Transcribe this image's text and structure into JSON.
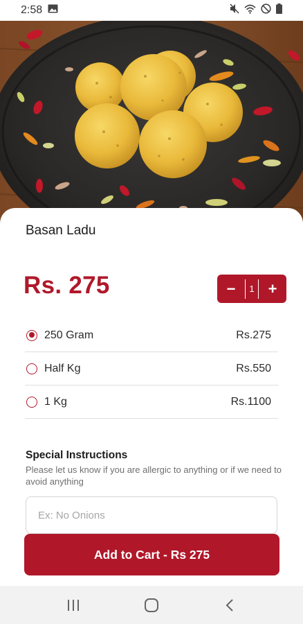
{
  "status_bar": {
    "time": "2:58",
    "icons": [
      "image-icon",
      "mute-icon",
      "wifi-icon",
      "do-not-disturb-icon",
      "battery-icon"
    ]
  },
  "product": {
    "name": "Basan Ladu",
    "price": "Rs. 275",
    "quantity": "1",
    "image": "ladoo-plate-photo"
  },
  "stepper": {
    "minus": "−",
    "plus": "+"
  },
  "options": [
    {
      "label": "250 Gram",
      "price": "Rs.275",
      "selected": true
    },
    {
      "label": "Half Kg",
      "price": "Rs.550",
      "selected": false
    },
    {
      "label": "1 Kg",
      "price": "Rs.1100",
      "selected": false
    }
  ],
  "special_instructions": {
    "title": "Special Instructions",
    "description": "Please let us know if you are allergic to anything or if we need to avoid anything",
    "placeholder": "Ex: No Onions",
    "value": ""
  },
  "cart_button": {
    "label": "Add to Cart - Rs 275"
  },
  "nav_bar": {
    "buttons": [
      "recent-apps-icon",
      "home-icon",
      "back-icon"
    ]
  },
  "colors": {
    "accent": "#b0182a",
    "nav_background": "#f2f2f2"
  }
}
